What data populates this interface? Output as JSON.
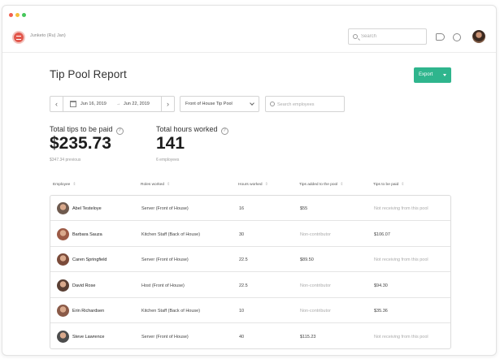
{
  "topbar": {
    "location_name": "Junketo (Ru) Jan)",
    "search_placeholder": "Search"
  },
  "page": {
    "title": "Tip Pool Report",
    "export_label": "Export"
  },
  "filters": {
    "date_start": "Jun 16, 2019",
    "date_separator": "→",
    "date_end": "Jun 22, 2019",
    "pool_selected": "Front of House Tip Pool",
    "employee_search_placeholder": "Search employees"
  },
  "stats": {
    "tips_label": "Total tips to be paid",
    "tips_value": "$235.73",
    "tips_sub": "$347.34 previous",
    "hours_label": "Total hours worked",
    "hours_value": "141",
    "hours_sub": "6 employees"
  },
  "table": {
    "columns": [
      "Employee",
      "Roles worked",
      "Hours worked",
      "Tips added to the pool",
      "Tips to be paid"
    ],
    "rows": [
      {
        "name": "Abel Testeloye",
        "role": "Server (Front of House)",
        "hours": "16",
        "added": "$55",
        "paid": "Not receiving from this pool",
        "avatar_color": "#6e5a4e"
      },
      {
        "name": "Barbara Sauza",
        "role": "Kitchen Staff (Back of House)",
        "hours": "30",
        "added": "Non-contributor",
        "paid": "$106.07",
        "avatar_color": "#9c5a45"
      },
      {
        "name": "Caren Springfield",
        "role": "Server (Front of House)",
        "hours": "22.5",
        "added": "$89.50",
        "paid": "Not receiving from this pool",
        "avatar_color": "#7b4b3a"
      },
      {
        "name": "David Rose",
        "role": "Host (Front of House)",
        "hours": "22.5",
        "added": "Non-contributor",
        "paid": "$94.30",
        "avatar_color": "#5a3f33"
      },
      {
        "name": "Erin Richardsen",
        "role": "Kitchen Staff (Back of House)",
        "hours": "10",
        "added": "Non-contributor",
        "paid": "$35.36",
        "avatar_color": "#8a5a48"
      },
      {
        "name": "Steve Lawrence",
        "role": "Server (Front of House)",
        "hours": "40",
        "added": "$115.23",
        "paid": "Not receiving from this pool",
        "avatar_color": "#4c4c4c"
      }
    ]
  }
}
